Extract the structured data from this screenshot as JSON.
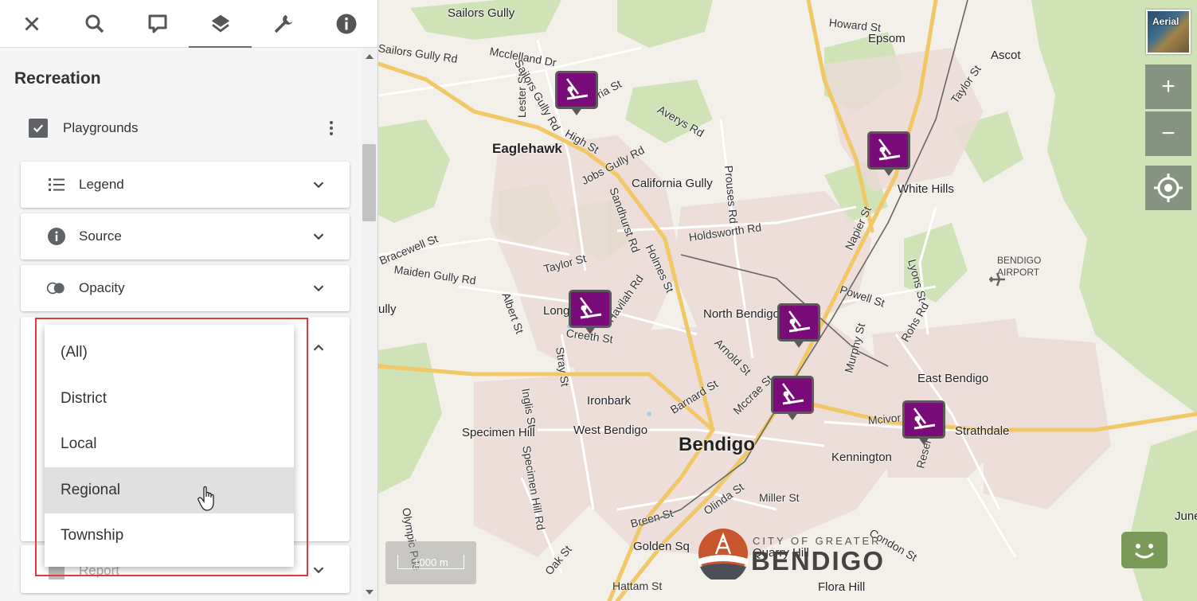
{
  "sidebar": {
    "section_title": "Recreation",
    "layer": {
      "label": "Playgrounds",
      "checked": true
    },
    "cards": [
      {
        "label": "Legend",
        "icon": "list-icon"
      },
      {
        "label": "Source",
        "icon": "info-icon"
      },
      {
        "label": "Opacity",
        "icon": "opacity-icon"
      }
    ],
    "hidden_card_label": "Report",
    "dropdown": {
      "options": [
        "(All)",
        "District",
        "Local",
        "Regional",
        "Township"
      ],
      "hovered": "Regional"
    }
  },
  "toolbar": {
    "buttons": [
      "close-icon",
      "search-icon",
      "comment-icon",
      "layers-icon",
      "wrench-icon",
      "info-icon"
    ],
    "active": "layers-icon"
  },
  "map": {
    "basemap_toggle_label": "Aerial",
    "zoom_in": "+",
    "zoom_out": "−",
    "scale_label": "1000 m",
    "logo": {
      "top": "CITY OF GREATER",
      "main": "BENDIGO"
    },
    "places": {
      "bendigo": "Bendigo",
      "eaglehawk": "Eaglehawk",
      "sailors_gully": "Sailors Gully",
      "epsom": "Epsom",
      "ascot": "Ascot",
      "california_gully": "California Gully",
      "white_hills": "White Hills",
      "north_bendigo": "North Bendigo",
      "long": "Long",
      "ironbark": "Ironbark",
      "east_bendigo": "East Bendigo",
      "specimen_hill": "Specimen Hill",
      "west_bendigo": "West Bendigo",
      "kennington": "Kennington",
      "strathdale": "Strathdale",
      "golden_sq": "Golden Sq",
      "quarry_hill": "Quarry Hill",
      "flora_hill": "Flora Hill",
      "june": "June",
      "ully": "ully",
      "airport_line1": "BENDIGO",
      "airport_line2": "AIRPORT"
    },
    "roads": {
      "howard": "Howard St",
      "sailors_gully_rd": "Sailors Gully Rd",
      "mcclelland": "Mcclelland Dr",
      "lester": "Lester St",
      "sailors_gully_rd2": "Sailors Gully Rd",
      "victoria": "Victoria St",
      "averys": "Averys Rd",
      "high": "High St",
      "jobs_gully": "Jobs Gully Rd",
      "taylor_st_ne": "Taylor St",
      "bracewell": "Bracewell St",
      "sandhurst": "Sandhurst Rd",
      "prouses": "Prouses Rd",
      "holdsworth": "Holdsworth Rd",
      "napier": "Napier St",
      "maiden_gully": "Maiden Gully Rd",
      "taylor_st": "Taylor St",
      "holmes": "Holmes St",
      "havilah": "Havilah Rd",
      "powell": "Powell St",
      "lyons": "Lyons St",
      "albert": "Albert St",
      "creeth": "Creeth St",
      "arnold": "Arnold St",
      "murphy": "Murphy St",
      "rohs": "Rohs Rd",
      "stray": "Stray St",
      "inglis": "Inglis St",
      "barnard": "Barnard St",
      "mccrae": "Mccrae St",
      "mcivor": "Mcivor Rd",
      "specimen_hill_rd": "Specimen Hill Rd",
      "olympic": "Olympic Pde",
      "reservoir": "Reservoir Rd",
      "breen": "Breen St",
      "olinda": "Olinda St",
      "miller": "Miller St",
      "condon": "Condon St",
      "oak": "Oak St",
      "hattam": "Hattam St"
    }
  }
}
